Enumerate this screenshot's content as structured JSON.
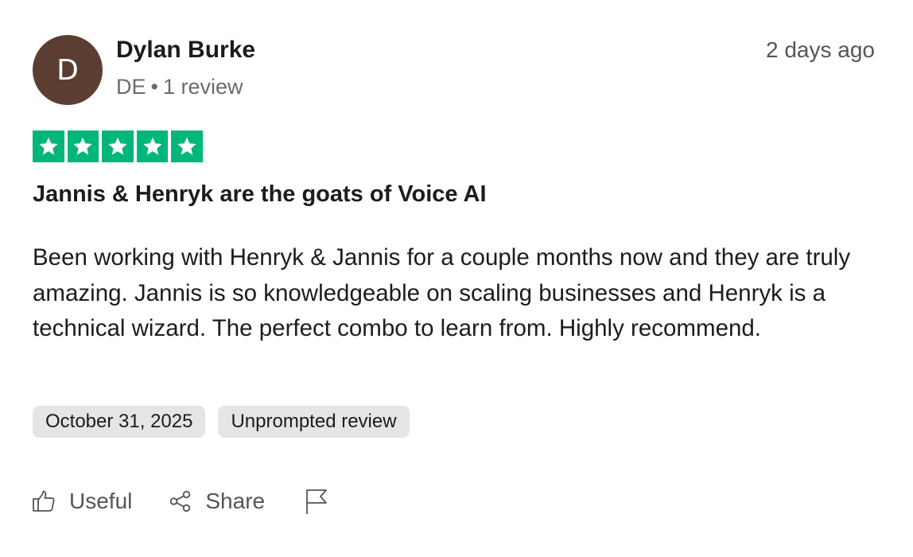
{
  "review": {
    "author": {
      "initial": "D",
      "name": "Dylan Burke",
      "country": "DE",
      "separator": "•",
      "review_count": "1 review",
      "avatar_color": "#5c3d32"
    },
    "posted_ago": "2 days ago",
    "rating": {
      "stars": 5,
      "max_stars": 5,
      "star_color": "#00b67a"
    },
    "title": "Jannis & Henryk are the goats of Voice AI",
    "body": "Been working with Henryk & Jannis for a couple months now and they are truly amazing. Jannis is so knowledgeable on scaling businesses and Henryk is a technical wizard. The perfect combo to learn from. Highly recommend.",
    "tags": {
      "date": "October 31, 2025",
      "type": "Unprompted review"
    },
    "actions": {
      "useful_label": "Useful",
      "useful_icon": "thumbs-up-icon",
      "share_label": "Share",
      "share_icon": "share-icon",
      "report_icon": "flag-icon"
    }
  }
}
